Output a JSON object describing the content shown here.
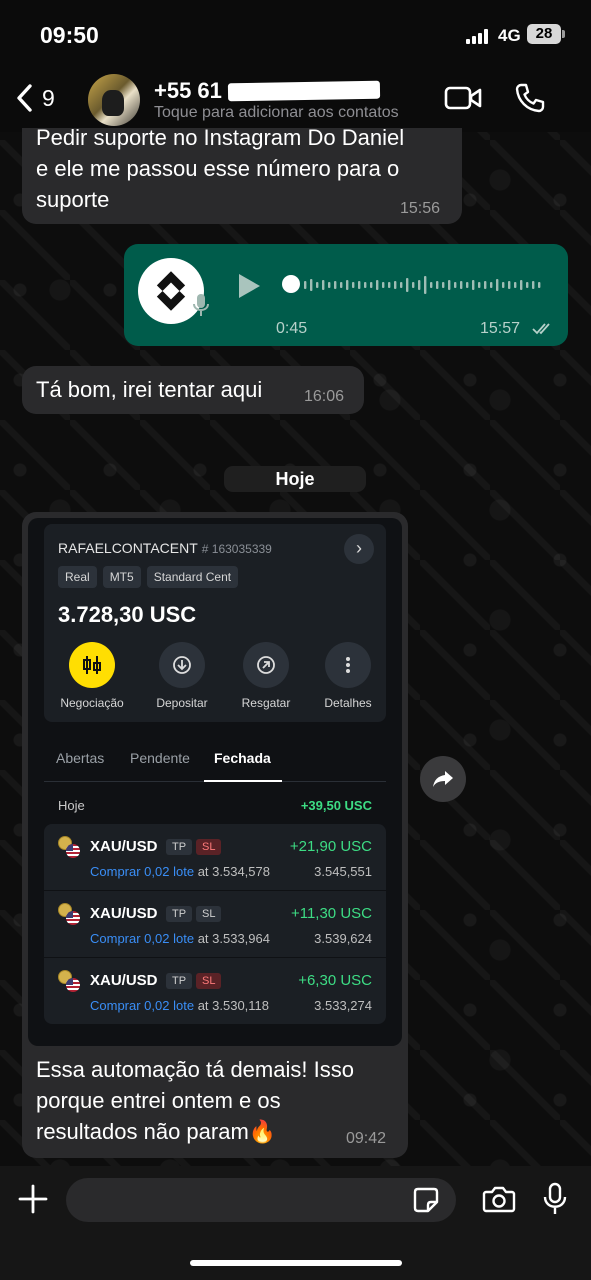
{
  "status_bar": {
    "time": "09:50",
    "network": "4G",
    "battery": "28"
  },
  "header": {
    "back_count": "9",
    "contact_name": "+55 61",
    "contact_subtitle": "Toque para adicionar aos contatos",
    "icons": {
      "back": "chevron-left-icon",
      "video": "video-camera-icon",
      "call": "phone-icon"
    }
  },
  "messages": [
    {
      "direction": "in",
      "text_lines": [
        "Pedir suporte no Instagram Do Daniel",
        "e ele me passou esse número para o",
        "suporte"
      ],
      "time": "15:56"
    },
    {
      "direction": "out",
      "type": "voice",
      "duration": "0:45",
      "time": "15:57",
      "status": "read"
    },
    {
      "direction": "in",
      "text": "Tá bom, irei tentar aqui",
      "time": "16:06"
    }
  ],
  "date_divider": "Hoje",
  "image_message": {
    "account": {
      "name": "RAFAELCONTACENT",
      "number": "# 163035339",
      "tags": [
        "Real",
        "MT5",
        "Standard Cent"
      ],
      "balance": "3.728,30 USC",
      "actions": [
        "Negociação",
        "Depositar",
        "Resgatar",
        "Detalhes"
      ]
    },
    "tabs": [
      "Abertas",
      "Pendente",
      "Fechada"
    ],
    "active_tab": "Fechada",
    "day_label": "Hoje",
    "day_total": "+39,50 USC",
    "trades": [
      {
        "symbol": "XAU/USD",
        "tp": "TP",
        "sl": "SL",
        "sl_hit": true,
        "pnl": "+21,90 USC",
        "action": "Comprar 0,02 lote",
        "open": "at 3.534,578",
        "close": "3.545,551"
      },
      {
        "symbol": "XAU/USD",
        "tp": "TP",
        "sl": "SL",
        "sl_hit": false,
        "pnl": "+11,30 USC",
        "action": "Comprar 0,02 lote",
        "open": "at 3.533,964",
        "close": "3.539,624"
      },
      {
        "symbol": "XAU/USD",
        "tp": "TP",
        "sl": "SL",
        "sl_hit": true,
        "pnl": "+6,30 USC",
        "action": "Comprar 0,02 lote",
        "open": "at 3.530,118",
        "close": "3.533,274"
      }
    ],
    "caption_lines": [
      "Essa automação tá demais! Isso",
      "porque entrei ontem e os",
      "resultados não param🔥"
    ],
    "time": "09:42"
  },
  "input": {
    "placeholder": ""
  },
  "colors": {
    "outgoing_bubble": "#005c4b",
    "incoming_bubble": "#2a2a2c",
    "profit_green": "#3ddc84",
    "buy_blue": "#3a8ef6",
    "accent_yellow": "#ffde02"
  }
}
